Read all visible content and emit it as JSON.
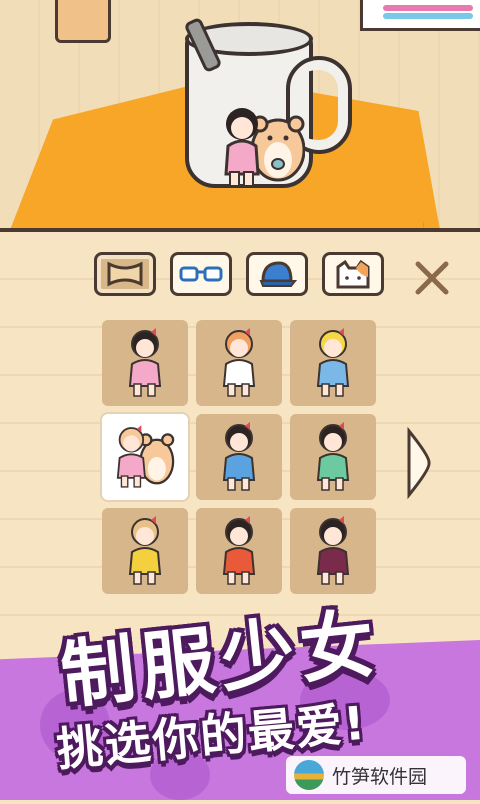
{
  "tabs": [
    {
      "name": "bow-tab",
      "icon": "bow-icon",
      "active": true
    },
    {
      "name": "glasses-tab",
      "icon": "glasses-icon",
      "active": false
    },
    {
      "name": "hat-tab",
      "icon": "cap-icon",
      "active": false
    },
    {
      "name": "cat-ears-tab",
      "icon": "cat-icon",
      "active": false
    }
  ],
  "close_icon": "close-icon",
  "next_icon": "chevron-right-icon",
  "outfits": [
    {
      "name": "pink-dress-girl",
      "colors": [
        "#f4a9c8",
        "#2b2422"
      ]
    },
    {
      "name": "cat-hood-girl",
      "colors": [
        "#ffffff",
        "#f0a060"
      ]
    },
    {
      "name": "alice-girl",
      "colors": [
        "#7ab8e8",
        "#f4d84a"
      ]
    },
    {
      "name": "pink-dress-hamster",
      "colors": [
        "#f4a9c8",
        "#f6c89a"
      ],
      "selected": true
    },
    {
      "name": "blue-dress-girl",
      "colors": [
        "#5aa3e0",
        "#2b2422"
      ]
    },
    {
      "name": "green-dress-girl",
      "colors": [
        "#6cc9a0",
        "#2b2422"
      ]
    },
    {
      "name": "straw-hat-girl",
      "colors": [
        "#f4cf3e",
        "#e6c28a"
      ]
    },
    {
      "name": "qipao-girl",
      "colors": [
        "#e85a3a",
        "#2b2422"
      ]
    },
    {
      "name": "ninja-girl",
      "colors": [
        "#7a2a4a",
        "#2b2422"
      ]
    }
  ],
  "banner": {
    "title": "制服少女",
    "subtitle": "挑选你的最爱!"
  },
  "watermark": "竹笋软件园",
  "colors": {
    "rug": "#f7a627",
    "panel": "#f7e4c3",
    "banner_purple": "#c777dd",
    "outline": "#4a3a32"
  }
}
